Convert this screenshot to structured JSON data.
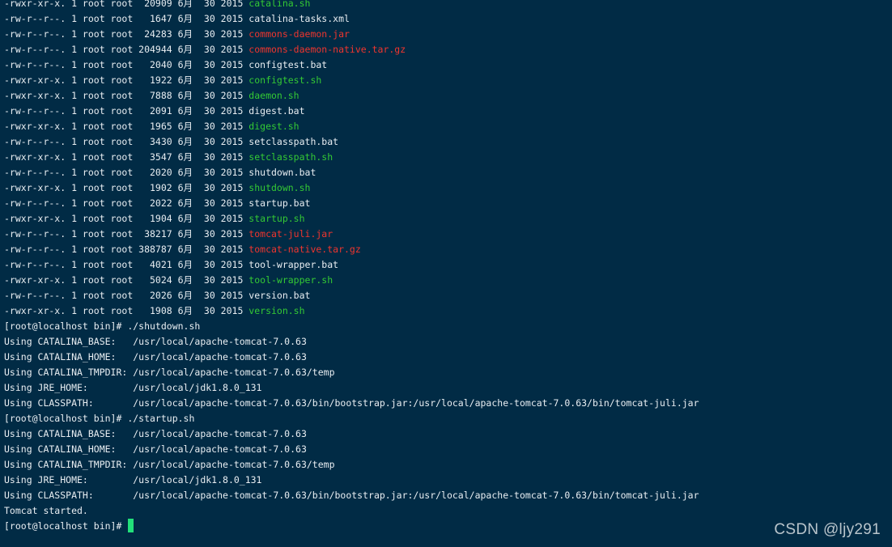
{
  "colors": {
    "background": "#012b45",
    "text": "#e9eef2",
    "executable": "#34c934",
    "archive": "#f0352e",
    "cursor": "#22e07a"
  },
  "listing": [
    {
      "perm": "-rwxr-xr-x.",
      "links": "1",
      "owner": "root",
      "group": "root",
      "size": "20909",
      "month": "6月",
      "day": "30",
      "year": "2015",
      "name": "catalina.sh",
      "kind": "exec"
    },
    {
      "perm": "-rw-r--r--.",
      "links": "1",
      "owner": "root",
      "group": "root",
      "size": "1647",
      "month": "6月",
      "day": "30",
      "year": "2015",
      "name": "catalina-tasks.xml",
      "kind": "plain"
    },
    {
      "perm": "-rw-r--r--.",
      "links": "1",
      "owner": "root",
      "group": "root",
      "size": "24283",
      "month": "6月",
      "day": "30",
      "year": "2015",
      "name": "commons-daemon.jar",
      "kind": "archive"
    },
    {
      "perm": "-rw-r--r--.",
      "links": "1",
      "owner": "root",
      "group": "root",
      "size": "204944",
      "month": "6月",
      "day": "30",
      "year": "2015",
      "name": "commons-daemon-native.tar.gz",
      "kind": "archive"
    },
    {
      "perm": "-rw-r--r--.",
      "links": "1",
      "owner": "root",
      "group": "root",
      "size": "2040",
      "month": "6月",
      "day": "30",
      "year": "2015",
      "name": "configtest.bat",
      "kind": "plain"
    },
    {
      "perm": "-rwxr-xr-x.",
      "links": "1",
      "owner": "root",
      "group": "root",
      "size": "1922",
      "month": "6月",
      "day": "30",
      "year": "2015",
      "name": "configtest.sh",
      "kind": "exec"
    },
    {
      "perm": "-rwxr-xr-x.",
      "links": "1",
      "owner": "root",
      "group": "root",
      "size": "7888",
      "month": "6月",
      "day": "30",
      "year": "2015",
      "name": "daemon.sh",
      "kind": "exec"
    },
    {
      "perm": "-rw-r--r--.",
      "links": "1",
      "owner": "root",
      "group": "root",
      "size": "2091",
      "month": "6月",
      "day": "30",
      "year": "2015",
      "name": "digest.bat",
      "kind": "plain"
    },
    {
      "perm": "-rwxr-xr-x.",
      "links": "1",
      "owner": "root",
      "group": "root",
      "size": "1965",
      "month": "6月",
      "day": "30",
      "year": "2015",
      "name": "digest.sh",
      "kind": "exec"
    },
    {
      "perm": "-rw-r--r--.",
      "links": "1",
      "owner": "root",
      "group": "root",
      "size": "3430",
      "month": "6月",
      "day": "30",
      "year": "2015",
      "name": "setclasspath.bat",
      "kind": "plain"
    },
    {
      "perm": "-rwxr-xr-x.",
      "links": "1",
      "owner": "root",
      "group": "root",
      "size": "3547",
      "month": "6月",
      "day": "30",
      "year": "2015",
      "name": "setclasspath.sh",
      "kind": "exec"
    },
    {
      "perm": "-rw-r--r--.",
      "links": "1",
      "owner": "root",
      "group": "root",
      "size": "2020",
      "month": "6月",
      "day": "30",
      "year": "2015",
      "name": "shutdown.bat",
      "kind": "plain"
    },
    {
      "perm": "-rwxr-xr-x.",
      "links": "1",
      "owner": "root",
      "group": "root",
      "size": "1902",
      "month": "6月",
      "day": "30",
      "year": "2015",
      "name": "shutdown.sh",
      "kind": "exec"
    },
    {
      "perm": "-rw-r--r--.",
      "links": "1",
      "owner": "root",
      "group": "root",
      "size": "2022",
      "month": "6月",
      "day": "30",
      "year": "2015",
      "name": "startup.bat",
      "kind": "plain"
    },
    {
      "perm": "-rwxr-xr-x.",
      "links": "1",
      "owner": "root",
      "group": "root",
      "size": "1904",
      "month": "6月",
      "day": "30",
      "year": "2015",
      "name": "startup.sh",
      "kind": "exec"
    },
    {
      "perm": "-rw-r--r--.",
      "links": "1",
      "owner": "root",
      "group": "root",
      "size": "38217",
      "month": "6月",
      "day": "30",
      "year": "2015",
      "name": "tomcat-juli.jar",
      "kind": "archive"
    },
    {
      "perm": "-rw-r--r--.",
      "links": "1",
      "owner": "root",
      "group": "root",
      "size": "388787",
      "month": "6月",
      "day": "30",
      "year": "2015",
      "name": "tomcat-native.tar.gz",
      "kind": "archive"
    },
    {
      "perm": "-rw-r--r--.",
      "links": "1",
      "owner": "root",
      "group": "root",
      "size": "4021",
      "month": "6月",
      "day": "30",
      "year": "2015",
      "name": "tool-wrapper.bat",
      "kind": "plain"
    },
    {
      "perm": "-rwxr-xr-x.",
      "links": "1",
      "owner": "root",
      "group": "root",
      "size": "5024",
      "month": "6月",
      "day": "30",
      "year": "2015",
      "name": "tool-wrapper.sh",
      "kind": "exec"
    },
    {
      "perm": "-rw-r--r--.",
      "links": "1",
      "owner": "root",
      "group": "root",
      "size": "2026",
      "month": "6月",
      "day": "30",
      "year": "2015",
      "name": "version.bat",
      "kind": "plain"
    },
    {
      "perm": "-rwxr-xr-x.",
      "links": "1",
      "owner": "root",
      "group": "root",
      "size": "1908",
      "month": "6月",
      "day": "30",
      "year": "2015",
      "name": "version.sh",
      "kind": "exec"
    }
  ],
  "session": [
    {
      "type": "prompt",
      "text": "[root@localhost bin]# ./shutdown.sh"
    },
    {
      "type": "output",
      "text": "Using CATALINA_BASE:   /usr/local/apache-tomcat-7.0.63"
    },
    {
      "type": "output",
      "text": "Using CATALINA_HOME:   /usr/local/apache-tomcat-7.0.63"
    },
    {
      "type": "output",
      "text": "Using CATALINA_TMPDIR: /usr/local/apache-tomcat-7.0.63/temp"
    },
    {
      "type": "output",
      "text": "Using JRE_HOME:        /usr/local/jdk1.8.0_131"
    },
    {
      "type": "output",
      "text": "Using CLASSPATH:       /usr/local/apache-tomcat-7.0.63/bin/bootstrap.jar:/usr/local/apache-tomcat-7.0.63/bin/tomcat-juli.jar"
    },
    {
      "type": "prompt",
      "text": "[root@localhost bin]# ./startup.sh"
    },
    {
      "type": "output",
      "text": "Using CATALINA_BASE:   /usr/local/apache-tomcat-7.0.63"
    },
    {
      "type": "output",
      "text": "Using CATALINA_HOME:   /usr/local/apache-tomcat-7.0.63"
    },
    {
      "type": "output",
      "text": "Using CATALINA_TMPDIR: /usr/local/apache-tomcat-7.0.63/temp"
    },
    {
      "type": "output",
      "text": "Using JRE_HOME:        /usr/local/jdk1.8.0_131"
    },
    {
      "type": "output",
      "text": "Using CLASSPATH:       /usr/local/apache-tomcat-7.0.63/bin/bootstrap.jar:/usr/local/apache-tomcat-7.0.63/bin/tomcat-juli.jar"
    },
    {
      "type": "output",
      "text": "Tomcat started."
    }
  ],
  "final_prompt": "[root@localhost bin]# ",
  "watermark": "CSDN @ljy291"
}
